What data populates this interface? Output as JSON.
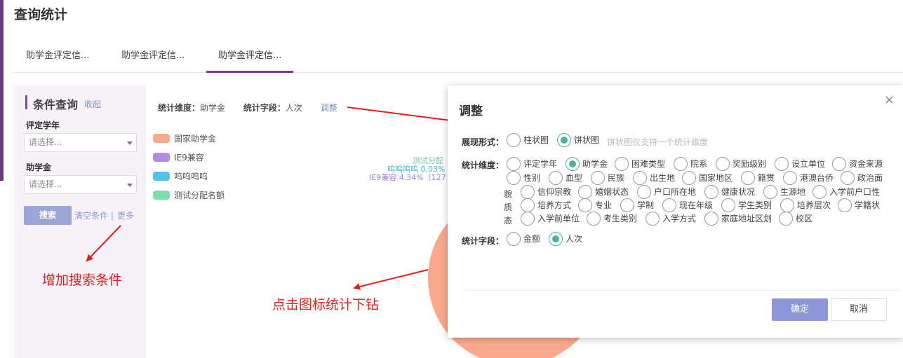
{
  "page": {
    "title": "查询统计"
  },
  "tabs": [
    {
      "label": "助学金评定信..."
    },
    {
      "label": "助学金评定信..."
    },
    {
      "label": "助学金评定信..."
    }
  ],
  "sidebar": {
    "title": "条件查询",
    "collapse": "收起",
    "fields": [
      {
        "label": "评定学年",
        "placeholder": "请选择..."
      },
      {
        "label": "助学金",
        "placeholder": "请选择..."
      }
    ],
    "search": "搜索",
    "clear": "清空条件 |",
    "more": "更多"
  },
  "stats": {
    "dimension_label": "统计维度：",
    "dimension_value": "助学金",
    "field_label": "统计字段：",
    "field_value": "人次",
    "adjust": "调整"
  },
  "legend": [
    {
      "label": "国家助学金",
      "color": "#fba98c"
    },
    {
      "label": "IE9兼容",
      "color": "#b18ce8"
    },
    {
      "label": "呜呜呜呜",
      "color": "#50c4ee"
    },
    {
      "label": "测试分配名额",
      "color": "#7cdcae"
    }
  ],
  "pie_labels": [
    {
      "text": "测试分配",
      "color": "#6ad0a2"
    },
    {
      "text": "呜呜呜呜 0.03%",
      "color": "#3db8e8"
    },
    {
      "text": "IE9兼容 4.34%（127",
      "color": "#a07de0"
    }
  ],
  "annotations": {
    "search": "增加搜索条件",
    "drill": "点击图标统计下钻"
  },
  "dialog": {
    "title": "调整",
    "close": "×",
    "display_label": "展现形式：",
    "display_options": [
      {
        "label": "柱状图",
        "checked": false
      },
      {
        "label": "饼状图",
        "checked": true
      }
    ],
    "display_hint": "饼状图仅支持一个统计维度",
    "dimension_label": "统计维度：",
    "dimension_options": [
      {
        "label": "评定学年",
        "checked": false
      },
      {
        "label": "助学金",
        "checked": true
      },
      {
        "label": "困难类型",
        "checked": false
      },
      {
        "label": "院系",
        "checked": false
      },
      {
        "label": "奖励级别",
        "checked": false
      },
      {
        "label": "设立单位",
        "checked": false
      },
      {
        "label": "资金来源",
        "checked": false
      },
      {
        "label": "性别",
        "checked": false
      },
      {
        "label": "血型",
        "checked": false
      },
      {
        "label": "民族",
        "checked": false
      },
      {
        "label": "出生地",
        "checked": false
      },
      {
        "label": "国家地区",
        "checked": false
      },
      {
        "label": "籍贯",
        "checked": false
      },
      {
        "label": "港澳台侨",
        "checked": false
      },
      {
        "label": "政治面",
        "checked": false
      },
      {
        "label": "信仰宗教",
        "checked": false
      },
      {
        "label": "婚姻状态",
        "checked": false
      },
      {
        "label": "户口所在地",
        "checked": false
      },
      {
        "label": "健康状况",
        "checked": false
      },
      {
        "label": "生源地",
        "checked": false
      },
      {
        "label": "入学前户口性",
        "checked": false
      },
      {
        "label": "培养方式",
        "checked": false
      },
      {
        "label": "专业",
        "checked": false
      },
      {
        "label": "学制",
        "checked": false
      },
      {
        "label": "现在年级",
        "checked": false
      },
      {
        "label": "学生类别",
        "checked": false
      },
      {
        "label": "培养层次",
        "checked": false
      },
      {
        "label": "学籍状",
        "checked": false
      },
      {
        "label": "入学前单位",
        "checked": false
      },
      {
        "label": "考生类别",
        "checked": false
      },
      {
        "label": "入学方式",
        "checked": false
      },
      {
        "label": "家庭地址区划",
        "checked": false
      },
      {
        "label": "校区",
        "checked": false
      }
    ],
    "wrap_chars": [
      "貌",
      "质",
      "态"
    ],
    "field_label": "统计字段：",
    "field_options": [
      {
        "label": "金额",
        "checked": false
      },
      {
        "label": "人次",
        "checked": true
      }
    ],
    "ok": "确定",
    "cancel": "取消"
  }
}
